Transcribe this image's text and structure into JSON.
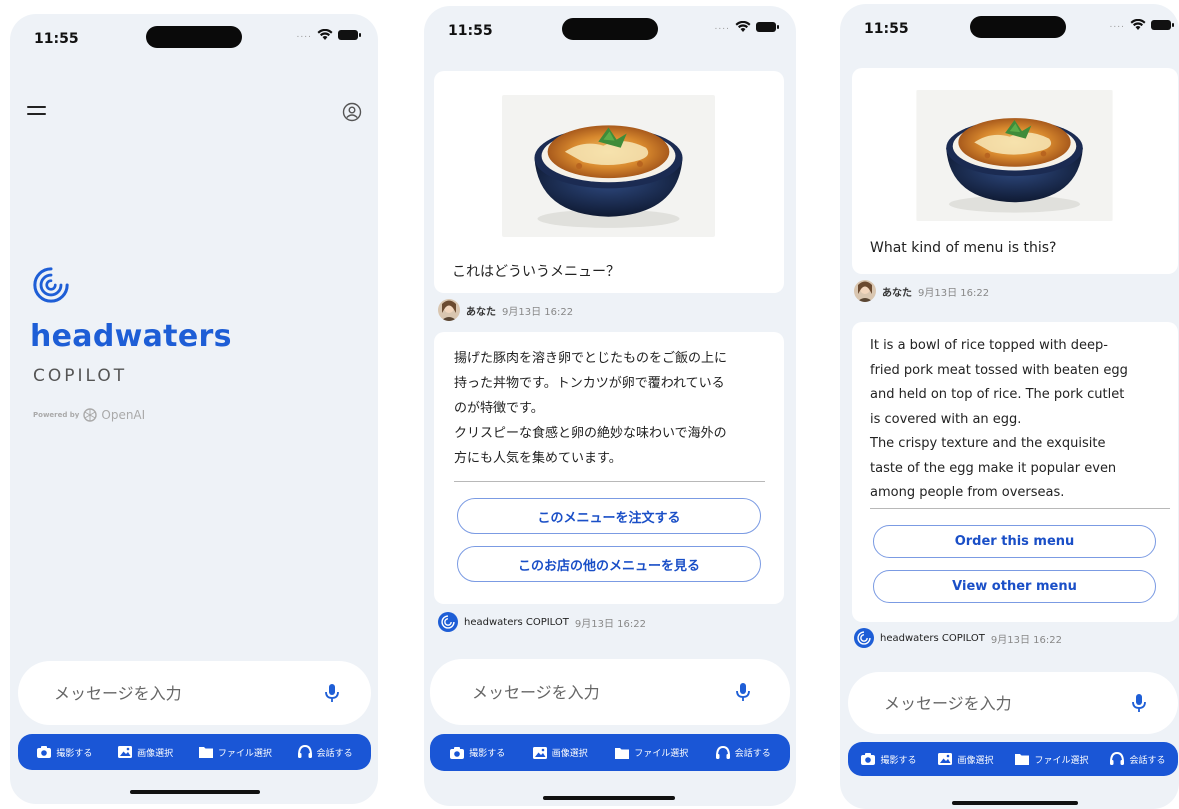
{
  "status": {
    "time": "11:55",
    "dots": "...."
  },
  "home": {
    "brand_name": "headwaters",
    "brand_sub": "COPILOT",
    "powered_by": "Powered by",
    "openai": "OpenAI"
  },
  "input": {
    "placeholder": "メッセージを入力"
  },
  "toolbar": {
    "camera": "撮影する",
    "image": "画像選択",
    "file": "ファイル選択",
    "talk": "会話する"
  },
  "chat_ja": {
    "user_message": "これはどういうメニュー？",
    "user_name": "あなた",
    "user_time": "9月13日 16:22",
    "answer": "揚げた豚肉を溶き卵でとじたものをご飯の上に\n持った丼物です。トンカツが卵で覆われている\nのが特徴です。\nクリスピーな食感と卵の絶妙な味わいで海外の\n方にも人気を集めています。",
    "order_button": "このメニューを注文する",
    "other_button": "このお店の他のメニューを見る",
    "bot_name": "headwaters COPILOT",
    "bot_time": "9月13日 16:22"
  },
  "chat_en": {
    "user_message": "What kind of menu is this?",
    "user_name": "あなた",
    "user_time": "9月13日 16:22",
    "answer": "It is a bowl of rice topped with deep-\nfried pork meat tossed with beaten egg\nand held on top of rice. The pork cutlet\nis covered with an egg.\nThe crispy texture and the exquisite\ntaste of the egg make it popular even\namong people from overseas.",
    "order_button": "Order this menu",
    "other_button": "View other menu",
    "bot_name": "headwaters COPILOT",
    "bot_time": "9月13日 16:22"
  },
  "colors": {
    "accent": "#1e5ed6",
    "toolbar": "#1a56d6",
    "screen_bg": "#eef2f7"
  }
}
